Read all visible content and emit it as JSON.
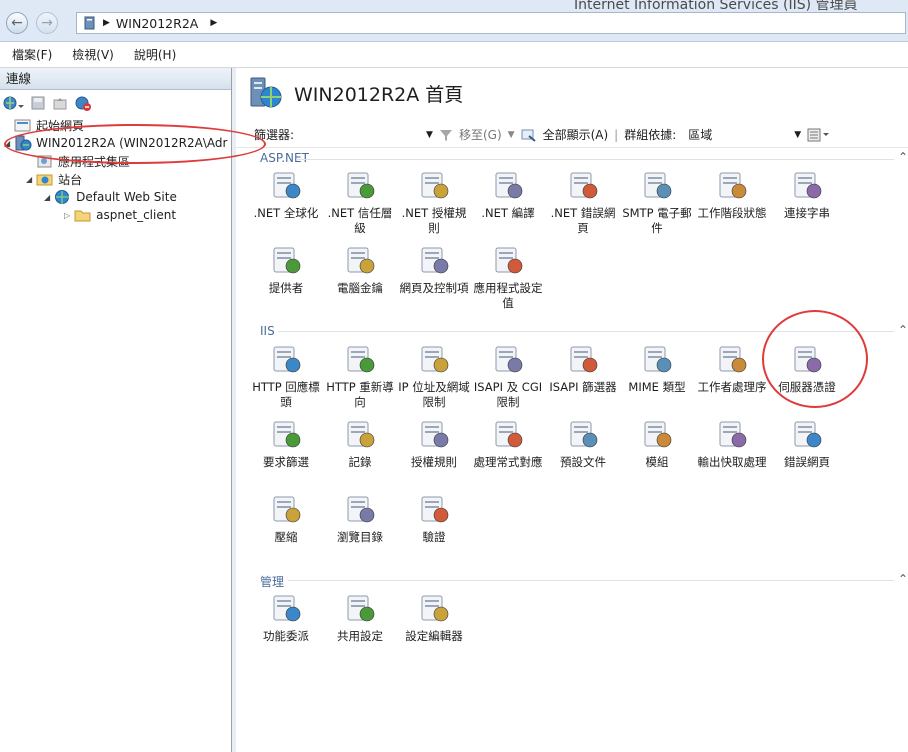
{
  "window": {
    "title": "Internet Information Services (IIS) 管理員"
  },
  "address": {
    "server": "WIN2012R2A"
  },
  "menu": [
    "檔案(F)",
    "檢視(V)",
    "說明(H)"
  ],
  "connections": {
    "header": "連線",
    "tree": [
      "起始網頁",
      "WIN2012R2A (WIN2012R2A\\Adr",
      "應用程式集區",
      "站台",
      "Default Web Site",
      "aspnet_client"
    ]
  },
  "page": {
    "title": "WIN2012R2A 首頁"
  },
  "filter": {
    "label": "篩選器:",
    "goto": "移至(G)",
    "showall": "全部顯示(A)",
    "groupby": "群組依據:",
    "groupvalue": "區域"
  },
  "groups": {
    "aspnet": {
      "name": "ASP.NET",
      "items": [
        ".NET 全球化",
        ".NET 信任層級",
        ".NET 授權規則",
        ".NET 編譯",
        ".NET 錯誤網頁",
        "SMTP 電子郵件",
        "工作階段狀態",
        "連接字串",
        "提供者",
        "電腦金鑰",
        "網頁及控制項",
        "應用程式設定值"
      ]
    },
    "iis": {
      "name": "IIS",
      "items": [
        "HTTP 回應標頭",
        "HTTP 重新導向",
        "IP 位址及網域限制",
        "ISAPI 及 CGI 限制",
        "ISAPI 篩選器",
        "MIME 類型",
        "工作者處理序",
        "伺服器憑證",
        "要求篩選",
        "記錄",
        "授權規則",
        "處理常式對應",
        "預設文件",
        "模組",
        "輸出快取處理",
        "錯誤網頁",
        "壓縮",
        "瀏覽目錄",
        "驗證"
      ]
    },
    "mgmt": {
      "name": "管理",
      "items": [
        "功能委派",
        "共用設定",
        "設定編輯器"
      ]
    }
  },
  "icons": {
    "server": "server-globe-icon",
    "tile": "feature-icon"
  },
  "colors": {
    "accent": "#4b6c9c",
    "highlight": "#e03a3a",
    "titlebar": "#dfe9f5"
  }
}
